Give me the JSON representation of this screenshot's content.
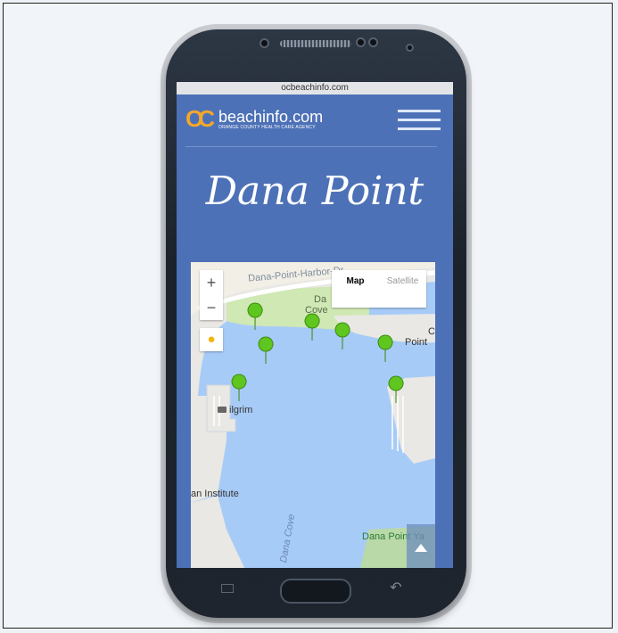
{
  "browser": {
    "url": "ocbeachinfo.com"
  },
  "header": {
    "logo_mark": "OC",
    "brand_name": "beachinfo.com",
    "brand_sub": "ORANGE COUNTY HEALTH CARE AGENCY"
  },
  "page": {
    "title": "Dana Point"
  },
  "map": {
    "zoom_in": "+",
    "zoom_out": "−",
    "type_map": "Map",
    "type_satellite": "Satellite",
    "labels": {
      "road": "Dana-Point-Harbor-Dr",
      "dana_cove_top_1": "Da",
      "dana_cove_top_2": "Cove",
      "point_1": "C",
      "point_2": "Point",
      "pilgrim": "ilgrim",
      "institute": "an Institute",
      "dana_cove_water": "Dana Cove",
      "harbor": "Dana Point Ya"
    },
    "marker_count": 8,
    "colors": {
      "water": "#a7cbf7",
      "land": "#e9e8e4",
      "park": "#cfe8b4",
      "marker": "#5ec61f"
    }
  },
  "colors": {
    "page_bg": "#4d71b7",
    "accent": "#f3a72a"
  }
}
